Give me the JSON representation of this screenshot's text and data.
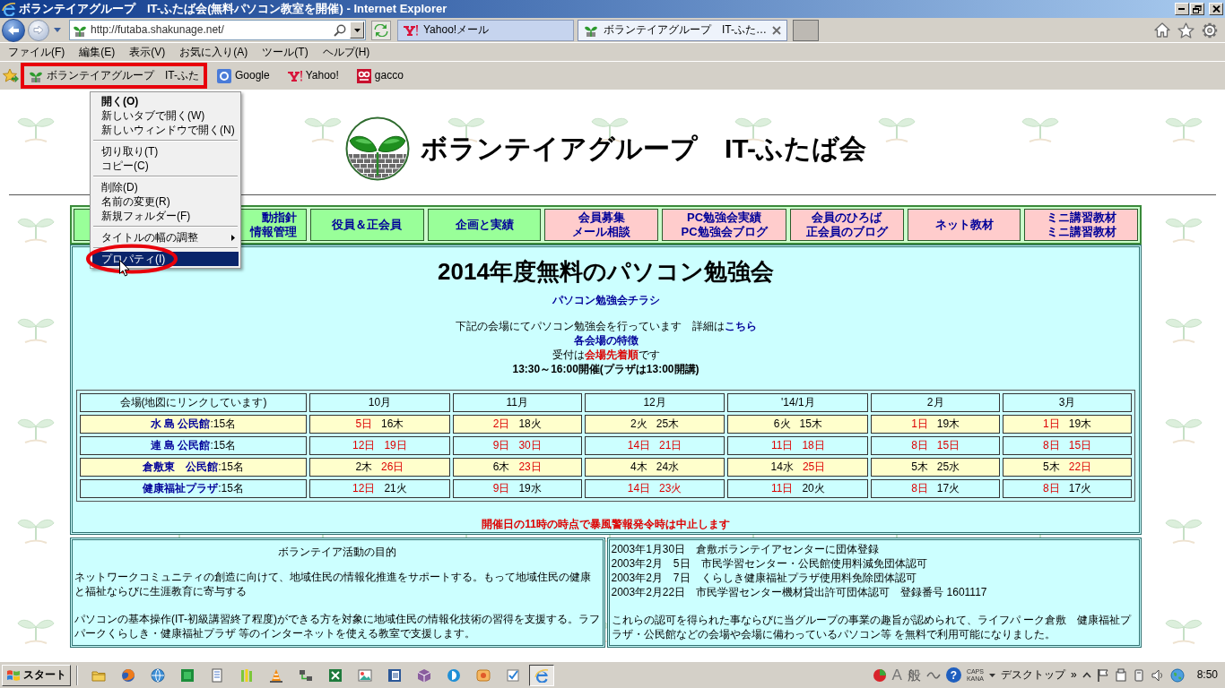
{
  "window": {
    "title": "ボランテイアグループ　IT-ふたば会(無料パソコン教室を開催) - Internet Explorer"
  },
  "address_bar": {
    "url": "http://futaba.shakunage.net/"
  },
  "tabs": [
    {
      "label": "Yahoo!メール",
      "selected": false
    },
    {
      "label": "ボランテイアグループ　IT-ふた…",
      "selected": true
    }
  ],
  "menu_bar": [
    "ファイル(F)",
    "編集(E)",
    "表示(V)",
    "お気に入り(A)",
    "ツール(T)",
    "ヘルプ(H)"
  ],
  "favorites": [
    {
      "label": "ボランテイアグループ　IT-ふた",
      "highlighted": true
    },
    {
      "label": "Google",
      "highlighted": false
    },
    {
      "label": "Yahoo!",
      "highlighted": false
    },
    {
      "label": "gacco",
      "highlighted": false
    }
  ],
  "context_menu": {
    "items": [
      {
        "kind": "item",
        "label": "開く(O)",
        "default": true,
        "selected": false,
        "circled": false
      },
      {
        "kind": "item",
        "label": "新しいタブで開く(W)",
        "default": false,
        "selected": false,
        "circled": false
      },
      {
        "kind": "item",
        "label": "新しいウィンドウで開く(N)",
        "default": false,
        "selected": false,
        "circled": false
      },
      {
        "kind": "separator"
      },
      {
        "kind": "item",
        "label": "切り取り(T)",
        "default": false,
        "selected": false,
        "circled": false
      },
      {
        "kind": "item",
        "label": "コピー(C)",
        "default": false,
        "selected": false,
        "circled": false
      },
      {
        "kind": "separator"
      },
      {
        "kind": "item",
        "label": "削除(D)",
        "default": false,
        "selected": false,
        "circled": false
      },
      {
        "kind": "item",
        "label": "名前の変更(R)",
        "default": false,
        "selected": false,
        "circled": false
      },
      {
        "kind": "item",
        "label": "新規フォルダー(F)",
        "default": false,
        "selected": false,
        "circled": false
      },
      {
        "kind": "separator"
      },
      {
        "kind": "submenu",
        "label": "タイトルの幅の調整",
        "default": false,
        "selected": false,
        "circled": false
      },
      {
        "kind": "separator"
      },
      {
        "kind": "item",
        "label": "プロパティ(I)",
        "default": false,
        "selected": true,
        "circled": true
      }
    ]
  },
  "page": {
    "heading": "ボランテイアグループ　IT-ふたば会",
    "nav": [
      {
        "lines": [
          "動指針",
          "情報管理"
        ],
        "color": "#99ff99"
      },
      {
        "lines": [
          "役員＆正会員"
        ],
        "color": "#99ff99"
      },
      {
        "lines": [
          "企画と実績"
        ],
        "color": "#99ff99"
      },
      {
        "lines": [
          "会員募集",
          "メール相談"
        ],
        "color": "#ffcccc"
      },
      {
        "lines": [
          "PC勉強会実績",
          "PC勉強会ブログ"
        ],
        "color": "#ffcccc"
      },
      {
        "lines": [
          "会員のひろば",
          "正会員のブログ"
        ],
        "color": "#ffcccc"
      },
      {
        "lines": [
          "ネット教材"
        ],
        "color": "#ffcccc"
      },
      {
        "lines": [
          "ミニ講習教材",
          "ミニ講習教材"
        ],
        "color": "#ffcccc"
      }
    ],
    "notice": {
      "title": "2014年度無料のパソコン勉強会",
      "flyer_link": "パソコン勉強会チラシ",
      "intro": "下記の会場にてパソコン勉強会を行っています　詳細は",
      "details_link": "こちら",
      "features_link": "各会場の特徴",
      "reception": "受付は**会場先着順**です",
      "hours": "13:30～16:00開催(プラザは13:00開講)"
    },
    "schedule": {
      "columns": [
        "会場(地図にリンクしています)",
        "10月",
        "11月",
        "12月",
        "'14/1月",
        "2月",
        "3月"
      ],
      "rows": [
        {
          "venue": "水 島 公民館",
          "capacity": ":15名",
          "color": "#ffffcc",
          "dates": [
            [
              {
                "text": "5日",
                "holiday": true
              },
              {
                "text": "16木",
                "holiday": false
              }
            ],
            [
              {
                "text": "2日",
                "holiday": true
              },
              {
                "text": "18火",
                "holiday": false
              }
            ],
            [
              {
                "text": "2火",
                "holiday": false
              },
              {
                "text": "25木",
                "holiday": false
              }
            ],
            [
              {
                "text": "6火",
                "holiday": false
              },
              {
                "text": "15木",
                "holiday": false
              }
            ],
            [
              {
                "text": "1日",
                "holiday": true
              },
              {
                "text": "19木",
                "holiday": false
              }
            ],
            [
              {
                "text": "1日",
                "holiday": true
              },
              {
                "text": "19木",
                "holiday": false
              }
            ]
          ]
        },
        {
          "venue": "連 島 公民館",
          "capacity": ":15名",
          "color": "#ccffff",
          "dates": [
            [
              {
                "text": "12日",
                "holiday": true
              },
              {
                "text": "19日",
                "holiday": true
              }
            ],
            [
              {
                "text": "9日",
                "holiday": true
              },
              {
                "text": "30日",
                "holiday": true
              }
            ],
            [
              {
                "text": "14日",
                "holiday": true
              },
              {
                "text": "21日",
                "holiday": true
              }
            ],
            [
              {
                "text": "11日",
                "holiday": true
              },
              {
                "text": "18日",
                "holiday": true
              }
            ],
            [
              {
                "text": "8日",
                "holiday": true
              },
              {
                "text": "15日",
                "holiday": true
              }
            ],
            [
              {
                "text": "8日",
                "holiday": true
              },
              {
                "text": "15日",
                "holiday": true
              }
            ]
          ]
        },
        {
          "venue": "倉敷東　公民館",
          "capacity": ":15名",
          "color": "#ffffcc",
          "dates": [
            [
              {
                "text": "2木",
                "holiday": false
              },
              {
                "text": "26日",
                "holiday": true
              }
            ],
            [
              {
                "text": "6木",
                "holiday": false
              },
              {
                "text": "23日",
                "holiday": true
              }
            ],
            [
              {
                "text": "4木",
                "holiday": false
              },
              {
                "text": "24水",
                "holiday": false
              }
            ],
            [
              {
                "text": "14水",
                "holiday": false
              },
              {
                "text": "25日",
                "holiday": true
              }
            ],
            [
              {
                "text": "5木",
                "holiday": false
              },
              {
                "text": "25水",
                "holiday": false
              }
            ],
            [
              {
                "text": "5木",
                "holiday": false
              },
              {
                "text": "22日",
                "holiday": true
              }
            ]
          ]
        },
        {
          "venue": "健康福祉プラザ",
          "capacity": ":15名",
          "color": "#ccffff",
          "dates": [
            [
              {
                "text": "12日",
                "holiday": true
              },
              {
                "text": "21火",
                "holiday": false
              }
            ],
            [
              {
                "text": "9日",
                "holiday": true
              },
              {
                "text": "19水",
                "holiday": false
              }
            ],
            [
              {
                "text": "14日",
                "holiday": true
              },
              {
                "text": "23火",
                "holiday": true
              }
            ],
            [
              {
                "text": "11日",
                "holiday": true
              },
              {
                "text": "20火",
                "holiday": false
              }
            ],
            [
              {
                "text": "8日",
                "holiday": true
              },
              {
                "text": "17火",
                "holiday": false
              }
            ],
            [
              {
                "text": "8日",
                "holiday": true
              },
              {
                "text": "17火",
                "holiday": false
              }
            ]
          ]
        }
      ]
    },
    "warning": "開催日の11時の時点で暴風警報発令時は中止します"
  },
  "purpose": {
    "title": "ボランテイア活動の目的",
    "paragraphs": [
      "ネットワークコミュニティの創造に向けて、地域住民の情報化推進をサポートする。もって地域住民の健康と福祉ならびに生涯教育に寄与する",
      "パソコンの基本操作(IT-初級講習終了程度)ができる方を対象に地域住民の情報化技術の習得を支援する。ラフパークくらしき・健康福祉プラザ 等のインターネットを使える教室で支援します。"
    ]
  },
  "history": {
    "entries": [
      "2003年1月30日　倉敷ボランテイアセンターに団体登録",
      "2003年2月　5日　市民学習センター・公民館使用料減免団体認可",
      "2003年2月　7日　くらしき健康福祉プラザ使用料免除団体認可",
      "2003年2月22日　市民学習センター機材貸出許可団体認可　登録番号 1601117"
    ],
    "note": "これらの認可を得られた事ならびに当グループの事業の趣旨が認められて、ライフパ ーク倉敷　健康福祉プラザ・公民館などの会場や会場に備わっているパソコン等 を無料で利用可能になりました。"
  },
  "taskbar": {
    "start_label": "スタート",
    "ime_mode": "A",
    "ime_input": "般",
    "help": "?",
    "lock_keys": [
      "CAPS",
      "KANA"
    ],
    "toolbar_label": "デスクトップ",
    "overflow": "»",
    "clock": "8:50"
  }
}
